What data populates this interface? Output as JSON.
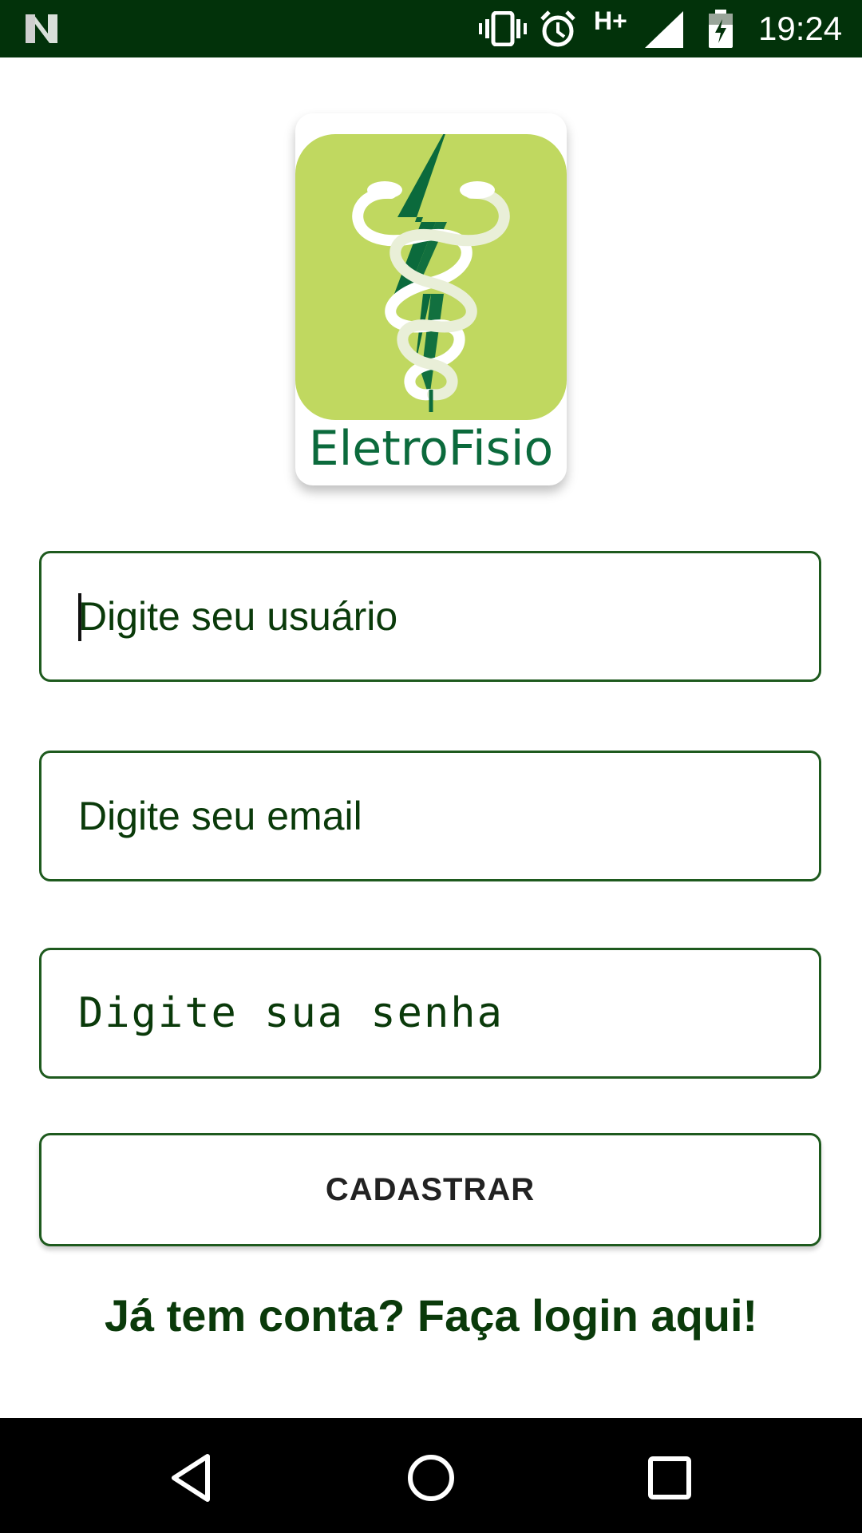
{
  "status_bar": {
    "network_type": "H+",
    "time": "19:24",
    "icons": [
      "n-logo-icon",
      "vibrate-icon",
      "alarm-icon",
      "signal-icon",
      "battery-charging-icon"
    ]
  },
  "logo": {
    "wordmark": "EletroFisio",
    "colors": {
      "background": "#c0d860",
      "accent": "#0b6a3c"
    }
  },
  "form": {
    "username_placeholder": "Digite seu usuário",
    "email_placeholder": "Digite seu email",
    "password_placeholder": "Digite sua senha",
    "register_label": "CADASTRAR",
    "login_link": "Já tem conta? Faça login aqui!"
  },
  "nav_bar": {
    "buttons": [
      "back-icon",
      "home-icon",
      "recents-icon"
    ]
  },
  "colors": {
    "status_bar": "#02320a",
    "border": "#1e5a1e",
    "text": "#0a3a0a"
  }
}
